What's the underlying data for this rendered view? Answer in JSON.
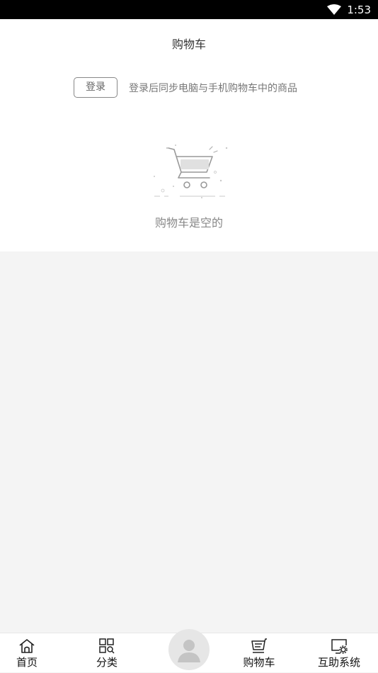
{
  "status_bar": {
    "time": "1:53",
    "icons": [
      "wifi-icon"
    ]
  },
  "header": {
    "title": "购物车"
  },
  "login": {
    "button_label": "登录",
    "hint": "登录后同步电脑与手机购物车中的商品"
  },
  "empty_state": {
    "illustration": "empty-cart-icon",
    "text": "购物车是空的"
  },
  "bottom_nav": {
    "items": [
      {
        "label": "首页",
        "icon": "home-icon"
      },
      {
        "label": "分类",
        "icon": "category-icon"
      },
      {
        "label": "",
        "icon": "avatar-icon"
      },
      {
        "label": "购物车",
        "icon": "cart-icon"
      },
      {
        "label": "互助系统",
        "icon": "monitor-gear-icon"
      }
    ]
  }
}
